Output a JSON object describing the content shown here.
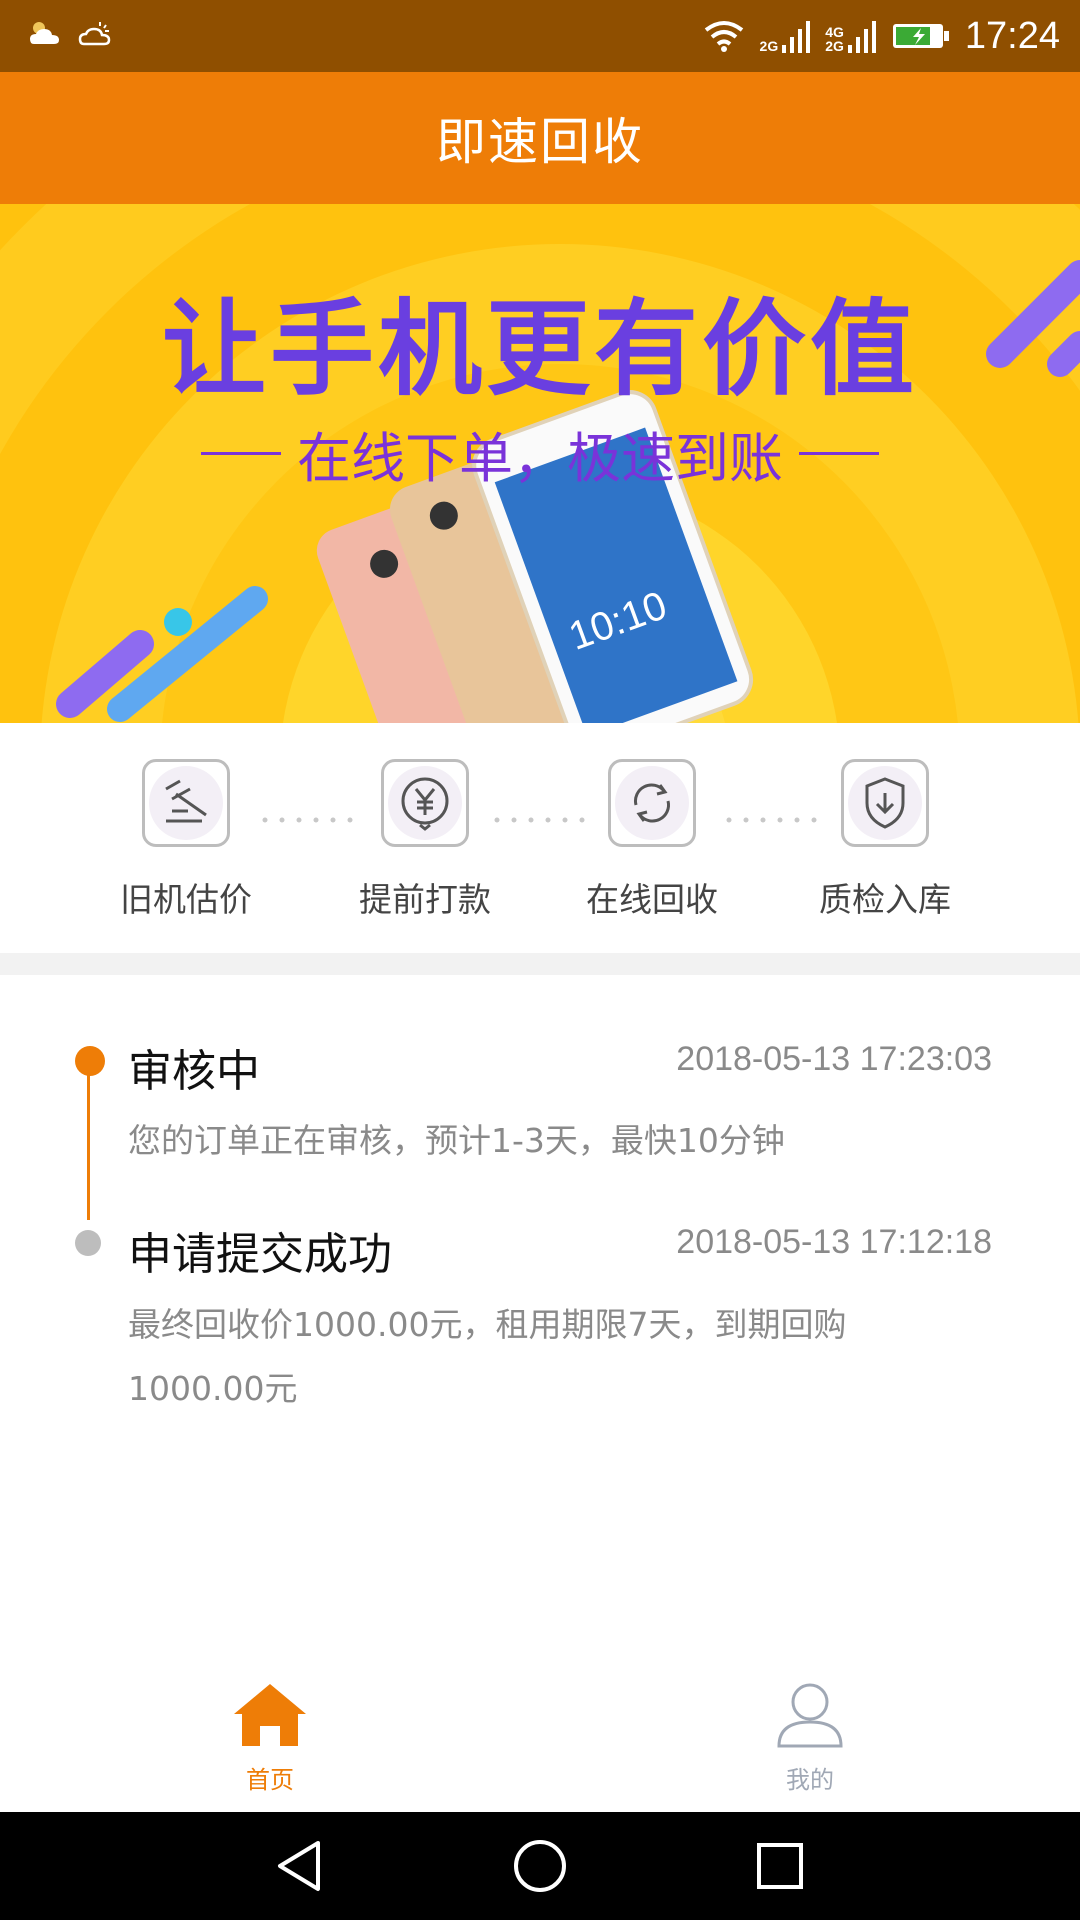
{
  "status_bar": {
    "time": "17:24",
    "net_2g": "2G",
    "net_4g": "4G",
    "net_2g_b": "2G",
    "icons": [
      "weather-cloud-icon",
      "weather-partly-cloudy-icon",
      "wifi-icon",
      "signal-icon",
      "signal-icon-2",
      "battery-charging-icon"
    ]
  },
  "header": {
    "title": "即速回收"
  },
  "banner": {
    "headline": "让手机更有价值",
    "subline": "在线下单，极速到账",
    "phone_time": "10:10",
    "colors": {
      "bg": "#FFC20E",
      "headline": "#6A3FE0",
      "subline": "#7A33D9"
    }
  },
  "steps": [
    {
      "label": "旧机估价",
      "icon": "gavel-icon"
    },
    {
      "label": "提前打款",
      "icon": "yuan-coin-icon"
    },
    {
      "label": "在线回收",
      "icon": "refresh-icon"
    },
    {
      "label": "质检入库",
      "icon": "shield-download-icon"
    }
  ],
  "timeline": [
    {
      "title": "审核中",
      "time": "2018-05-13 17:23:03",
      "desc": "您的订单正在审核，预计1-3天，最快10分钟",
      "status": "active"
    },
    {
      "title": "申请提交成功",
      "time": "2018-05-13 17:12:18",
      "desc": "最终回收价1000.00元，租用期限7天，到期回购1000.00元",
      "status": "done"
    }
  ],
  "tabs": [
    {
      "label": "首页",
      "icon": "home-icon",
      "active": true
    },
    {
      "label": "我的",
      "icon": "user-icon",
      "active": false
    }
  ],
  "colors": {
    "accent": "#EE7D07",
    "status_bar": "#8F4F00",
    "inactive": "#A0A8B5"
  },
  "nav": {
    "icons": [
      "back-triangle-icon",
      "home-circle-icon",
      "recent-square-icon"
    ]
  }
}
